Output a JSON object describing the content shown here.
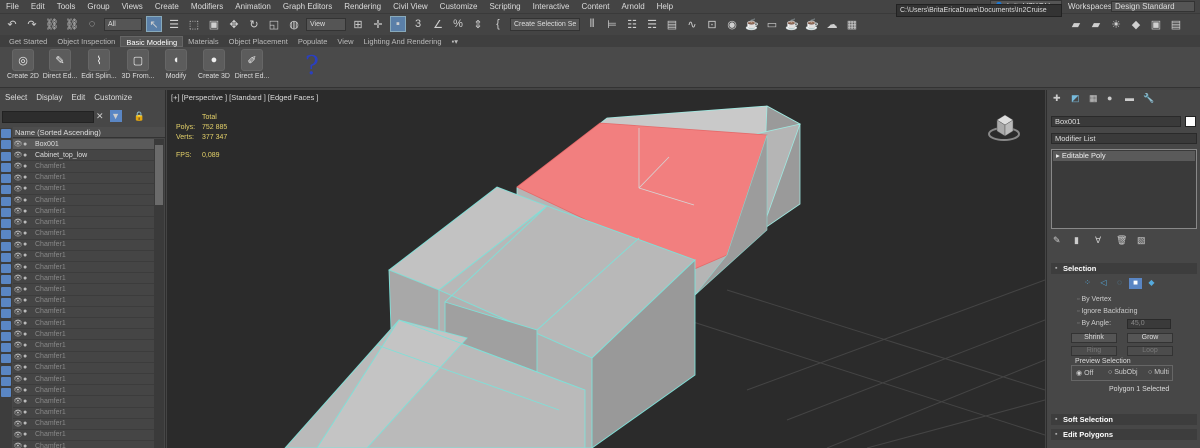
{
  "menubar": {
    "items": [
      "File",
      "Edit",
      "Tools",
      "Group",
      "Views",
      "Create",
      "Modifiers",
      "Animation",
      "Graph Editors",
      "Rendering",
      "Civil View",
      "Customize",
      "Scripting",
      "Interactive",
      "Content",
      "Arnold",
      "Help"
    ],
    "user": "britaU7XQU",
    "workspaces_label": "Workspaces:",
    "workspace": "Design Standard"
  },
  "toolbar": {
    "filter_dropdown": "All",
    "view_dropdown": "View",
    "selection_set": "Create Selection Se",
    "path": "C:\\Users\\BritaEricaDuwe\\Documents\\In2Cruise"
  },
  "ribbon": {
    "tabs": [
      "Get Started",
      "Object Inspection",
      "Basic Modeling",
      "Materials",
      "Object Placement",
      "Populate",
      "View",
      "Lighting And Rendering"
    ],
    "active_tab": "Basic Modeling",
    "buttons": [
      "Create 2D",
      "Direct Ed...",
      "Edit Splin...",
      "3D From...",
      "Modify",
      "Create 3D",
      "Direct Ed..."
    ],
    "annotation": "?"
  },
  "explorer": {
    "menu": [
      "Select",
      "Display",
      "Edit",
      "Customize"
    ],
    "column_header": "Name (Sorted Ascending)",
    "rows": [
      {
        "name": "Box001",
        "selected": true,
        "bright": true
      },
      {
        "name": "Cabinet_top_low",
        "selected": false,
        "bright": true
      },
      {
        "name": "Chamfer1"
      },
      {
        "name": "Chamfer1"
      },
      {
        "name": "Chamfer1"
      },
      {
        "name": "Chamfer1"
      },
      {
        "name": "Chamfer1"
      },
      {
        "name": "Chamfer1"
      },
      {
        "name": "Chamfer1"
      },
      {
        "name": "Chamfer1"
      },
      {
        "name": "Chamfer1"
      },
      {
        "name": "Chamfer1"
      },
      {
        "name": "Chamfer1"
      },
      {
        "name": "Chamfer1"
      },
      {
        "name": "Chamfer1"
      },
      {
        "name": "Chamfer1"
      },
      {
        "name": "Chamfer1"
      },
      {
        "name": "Chamfer1"
      },
      {
        "name": "Chamfer1"
      },
      {
        "name": "Chamfer1"
      },
      {
        "name": "Chamfer1"
      },
      {
        "name": "Chamfer1"
      },
      {
        "name": "Chamfer1"
      },
      {
        "name": "Chamfer1"
      },
      {
        "name": "Chamfer1"
      },
      {
        "name": "Chamfer1"
      },
      {
        "name": "Chamfer1"
      },
      {
        "name": "Chamfer1"
      },
      {
        "name": "Chamfer1"
      }
    ]
  },
  "viewport": {
    "label": "[+] [Perspective ] [Standard ] [Edged Faces ]",
    "stats_total": "Total",
    "polys_label": "Polys:",
    "polys": "752 885",
    "verts_label": "Verts:",
    "verts": "377 347",
    "fps_label": "FPS:",
    "fps": "0,089",
    "colors": {
      "selected_face": "#f47c7c",
      "edge": "#7fe0d8",
      "mesh": "#b9b9b9"
    }
  },
  "cmdpanel": {
    "object_name": "Box001",
    "modifier_list": "Modifier List",
    "modifier_stack": [
      "Editable Poly"
    ],
    "selection": {
      "title": "Selection",
      "by_vertex": "By Vertex",
      "ignore_backfacing": "Ignore Backfacing",
      "by_angle": "By Angle:",
      "angle_value": "45,0",
      "shrink": "Shrink",
      "grow": "Grow",
      "ring": "Ring",
      "loop": "Loop",
      "preview_selection": "Preview Selection",
      "off": "Off",
      "subobj": "SubObj",
      "multi": "Multi",
      "status": "Polygon 1 Selected"
    },
    "soft_selection": "Soft Selection",
    "edit_polygons": "Edit Polygons"
  }
}
